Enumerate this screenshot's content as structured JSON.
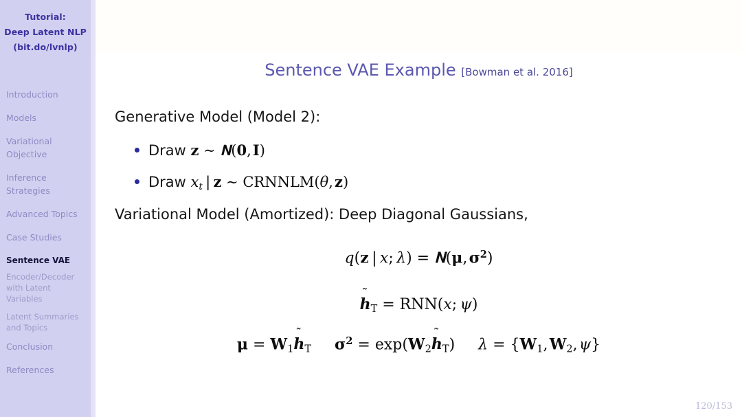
{
  "sidebar": {
    "title_lines": [
      "Tutorial:",
      "Deep Latent NLP",
      "(bit.do/lvnlp)"
    ],
    "accent_color": "#3b32a0",
    "background_color": "#d2d0f0",
    "items": [
      {
        "label": "Introduction",
        "level": "section",
        "active": false
      },
      {
        "label": "Models",
        "level": "section",
        "active": false
      },
      {
        "label": "Variational\nObjective",
        "level": "section",
        "active": false
      },
      {
        "label": "Inference\nStrategies",
        "level": "section",
        "active": false
      },
      {
        "label": "Advanced Topics",
        "level": "section",
        "active": false
      },
      {
        "label": "Case Studies",
        "level": "section",
        "active": false
      },
      {
        "label": "Sentence VAE",
        "level": "subsection",
        "active": true
      },
      {
        "label": "Encoder/Decoder\nwith Latent Variables",
        "level": "subsection",
        "active": false
      },
      {
        "label": "Latent Summaries\nand Topics",
        "level": "subsection",
        "active": false
      },
      {
        "label": "Conclusion",
        "level": "section",
        "active": false
      },
      {
        "label": "References",
        "level": "section",
        "active": false
      }
    ]
  },
  "slide": {
    "title": "Sentence VAE Example",
    "citation": "[Bowman et al. 2016]",
    "title_color": "#5b58b0",
    "page_number": "120/153",
    "generative_heading": "Generative Model (Model 2):",
    "variational_heading": "Variational Model (Amortized):  Deep Diagonal Gaussians,",
    "bullets": [
      {
        "lead": "Draw",
        "expression": "z ~ N(0, I)"
      },
      {
        "lead": "Draw",
        "expression": "x_t | z ~ CRNNLM(θ, z)"
      }
    ],
    "equations": [
      {
        "id": "posterior",
        "latex": "q(z | x; λ) = N(μ, σ²)"
      },
      {
        "id": "encoder-rnn",
        "latex": "h̃_T = RNN(x; ψ)"
      },
      {
        "id": "params",
        "latex": "μ = W₁h̃_T    σ² = exp(W₂h̃_T)    λ = {W₁, W₂, ψ}"
      }
    ]
  }
}
